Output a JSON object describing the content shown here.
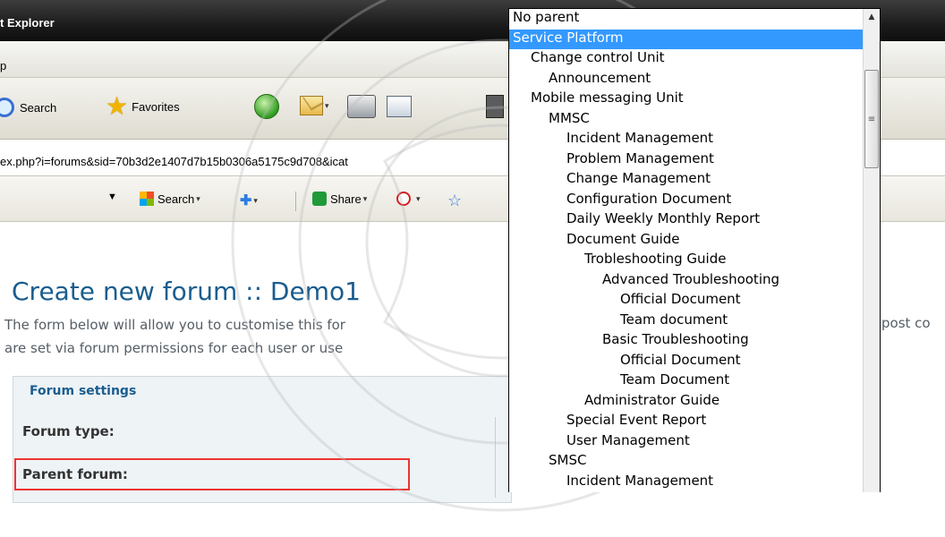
{
  "window": {
    "title": "t Explorer"
  },
  "menubar": {
    "text": "p"
  },
  "toolbar": {
    "search_label": "Search",
    "favorites_label": "Favorites"
  },
  "address": {
    "url": "ex.php?i=forums&sid=70b3d2e1407d7b15b0306a5175c9d708&icat"
  },
  "toolbar2": {
    "search_label": "Search",
    "share_label": "Share"
  },
  "page": {
    "title": "Create new forum :: Demo1",
    "intro_line1": "The form below will allow you to customise this for",
    "intro_line2": "are set via forum permissions for each user or use",
    "intro_trailing": "post co",
    "settings": {
      "legend": "Forum settings",
      "forum_type_label": "Forum type:",
      "parent_forum_label": "Parent forum:"
    }
  },
  "parent_dropdown": {
    "options": [
      {
        "label": "No parent",
        "level": 0,
        "selected": false
      },
      {
        "label": "Service Platform",
        "level": 0,
        "selected": true
      },
      {
        "label": "Change control Unit",
        "level": 1,
        "selected": false
      },
      {
        "label": "Announcement",
        "level": 2,
        "selected": false
      },
      {
        "label": "Mobile messaging Unit",
        "level": 1,
        "selected": false
      },
      {
        "label": "MMSC",
        "level": 2,
        "selected": false
      },
      {
        "label": "Incident Management",
        "level": 3,
        "selected": false
      },
      {
        "label": "Problem Management",
        "level": 3,
        "selected": false
      },
      {
        "label": "Change Management",
        "level": 3,
        "selected": false
      },
      {
        "label": "Configuration Document",
        "level": 3,
        "selected": false
      },
      {
        "label": "Daily Weekly Monthly Report",
        "level": 3,
        "selected": false
      },
      {
        "label": "Document Guide",
        "level": 3,
        "selected": false
      },
      {
        "label": "Trobleshooting Guide",
        "level": 4,
        "selected": false
      },
      {
        "label": "Advanced Troubleshooting",
        "level": 5,
        "selected": false
      },
      {
        "label": "Official Document",
        "level": 6,
        "selected": false
      },
      {
        "label": "Team document",
        "level": 6,
        "selected": false
      },
      {
        "label": "Basic Troubleshooting",
        "level": 5,
        "selected": false
      },
      {
        "label": "Official Document",
        "level": 6,
        "selected": false
      },
      {
        "label": "Team Document",
        "level": 6,
        "selected": false
      },
      {
        "label": "Administrator Guide",
        "level": 4,
        "selected": false
      },
      {
        "label": "Special Event Report",
        "level": 3,
        "selected": false
      },
      {
        "label": "User Management",
        "level": 3,
        "selected": false
      },
      {
        "label": "SMSC",
        "level": 2,
        "selected": false
      },
      {
        "label": "Incident Management",
        "level": 3,
        "selected": false
      }
    ]
  },
  "colors": {
    "selection": "#3399ff",
    "heading": "#1a5d8f",
    "highlight_box": "#ee3333"
  }
}
